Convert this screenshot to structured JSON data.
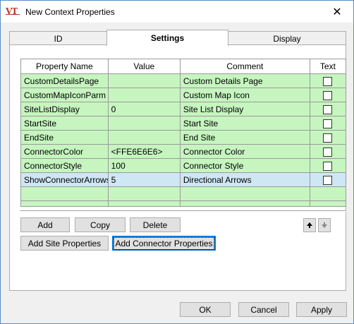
{
  "window": {
    "title": "New Context Properties",
    "icon": "vt-logo-icon",
    "close_glyph": "✕"
  },
  "tabs": [
    {
      "label": "ID",
      "active": false
    },
    {
      "label": "Settings",
      "active": true
    },
    {
      "label": "Display",
      "active": false
    }
  ],
  "grid": {
    "columns": [
      "Property Name",
      "Value",
      "Comment",
      "Text"
    ],
    "rows": [
      {
        "name": "CustomDetailsPage",
        "value": "",
        "comment": "Custom Details Page",
        "text_checked": false
      },
      {
        "name": "CustomMapIconParm",
        "value": "",
        "comment": "Custom Map Icon",
        "text_checked": false
      },
      {
        "name": "SiteListDisplay",
        "value": "0",
        "comment": "Site List Display",
        "text_checked": false
      },
      {
        "name": "StartSite",
        "value": "",
        "comment": "Start Site",
        "text_checked": false
      },
      {
        "name": "EndSite",
        "value": "",
        "comment": "End Site",
        "text_checked": false
      },
      {
        "name": "ConnectorColor",
        "value": "<FFE6E6E6>",
        "comment": "Connector Color",
        "text_checked": false
      },
      {
        "name": "ConnectorStyle",
        "value": "100",
        "comment": "Connector Style",
        "text_checked": false
      },
      {
        "name": "ShowConnectorArrows",
        "value": "5",
        "comment": "Directional Arrows",
        "text_checked": false,
        "selected": true
      },
      {
        "name": "",
        "value": "",
        "comment": "",
        "text_checked": null
      },
      {
        "name": "",
        "value": "",
        "comment": "",
        "text_checked": null
      }
    ],
    "row_color": "#c6f5bf",
    "selected_color": "#cfe6f4"
  },
  "buttons": {
    "add": "Add",
    "copy": "Copy",
    "delete": "Delete",
    "add_site_properties": "Add Site Properties",
    "add_connector_properties": "Add Connector Properties",
    "move_up_icon": "arrow-up-icon",
    "move_down_icon": "arrow-down-icon"
  },
  "footer": {
    "ok": "OK",
    "cancel": "Cancel",
    "apply": "Apply"
  }
}
